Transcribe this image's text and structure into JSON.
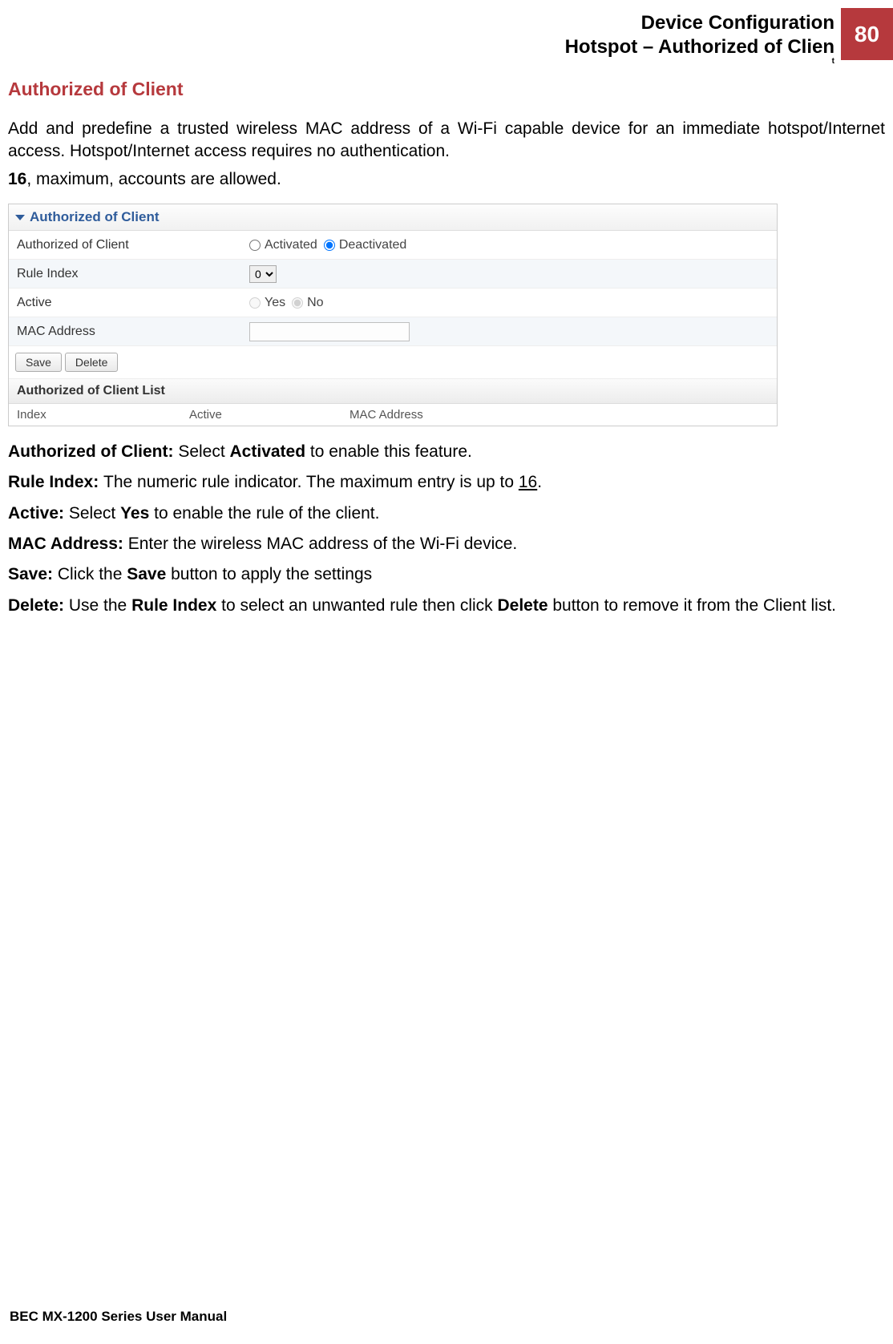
{
  "header": {
    "line1": "Device Configuration",
    "line2": "Hotspot – Authorized of Clien",
    "line3": "t",
    "page_number": "80"
  },
  "section_title": "Authorized of Client",
  "intro": {
    "p1": "Add and predefine a trusted wireless MAC address of a Wi-Fi capable device for an immediate hotspot/Internet access.   Hotspot/Internet access requires no authentication.",
    "p2_bold": "16",
    "p2_rest": ", maximum, accounts are allowed."
  },
  "panel": {
    "title": "Authorized of Client",
    "rows": {
      "authorized_label": "Authorized of Client",
      "activated": "Activated",
      "deactivated": "Deactivated",
      "rule_index_label": "Rule Index",
      "rule_index_value": "0",
      "active_label": "Active",
      "yes": "Yes",
      "no": "No",
      "mac_label": "MAC Address",
      "mac_value": ""
    },
    "buttons": {
      "save": "Save",
      "delete": "Delete"
    },
    "list": {
      "title": "Authorized of Client List",
      "col_index": "Index",
      "col_active": "Active",
      "col_mac": "MAC Address"
    }
  },
  "definitions": {
    "d1_label": "Authorized of Client: ",
    "d1_a": "Select ",
    "d1_bold": "Activated",
    "d1_b": " to enable this feature.",
    "d2_label": "Rule Index: ",
    "d2_a": "The numeric rule indicator.  The maximum entry is up to ",
    "d2_u": "16",
    "d2_b": ".",
    "d3_label": "Active: ",
    "d3_a": "Select ",
    "d3_bold": "Yes",
    "d3_b": " to enable the rule of the client.",
    "d4_label": "MAC Address: ",
    "d4_a": "Enter the wireless MAC address of the Wi-Fi device.",
    "d5_label": "Save: ",
    "d5_a": "Click the ",
    "d5_bold": "Save",
    "d5_b": " button to apply the settings",
    "d6_label": "Delete: ",
    "d6_a": "Use the ",
    "d6_bold": "Rule Index",
    "d6_b": " to select an unwanted rule then click ",
    "d6_bold2": "Delete",
    "d6_c": " button to remove it from the Client list."
  },
  "footer": "BEC MX-1200 Series User Manual"
}
